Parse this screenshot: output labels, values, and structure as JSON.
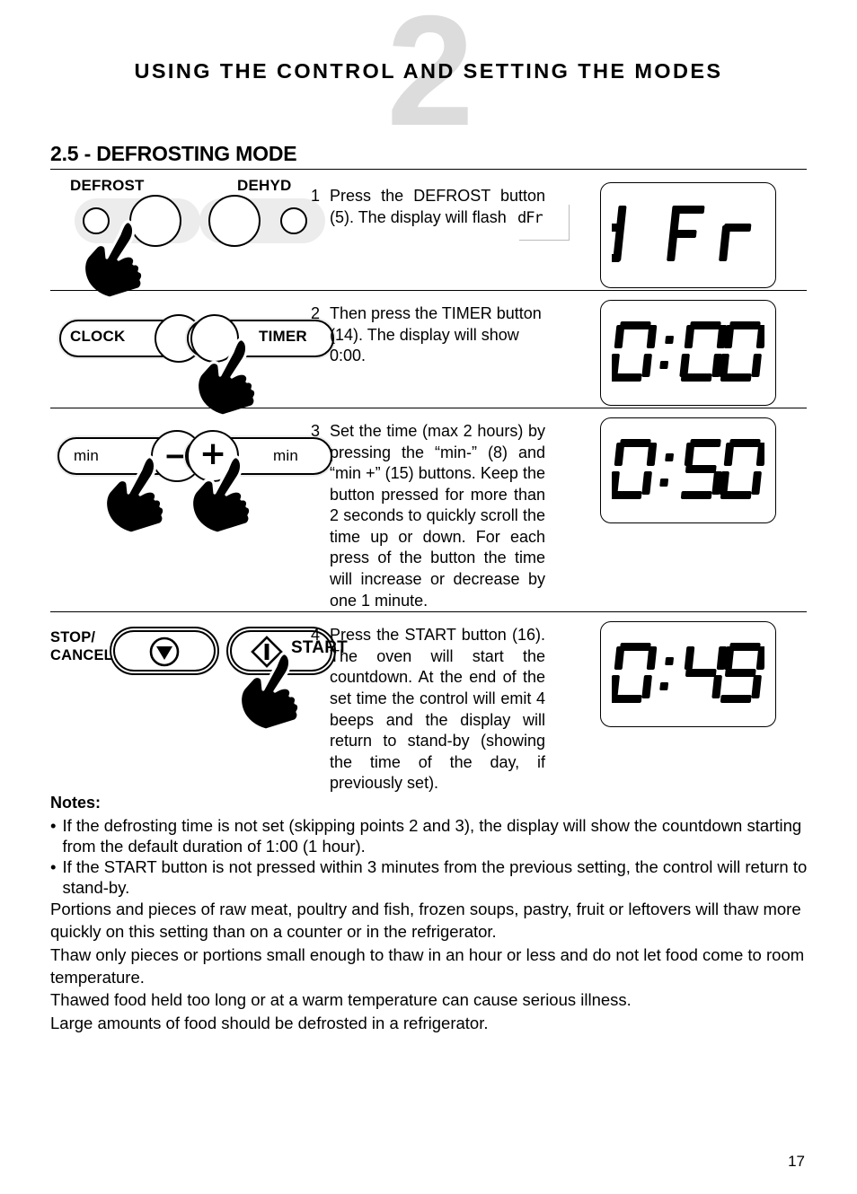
{
  "header": {
    "watermark": "2",
    "title": "USING THE CONTROL AND SETTING THE MODES"
  },
  "section": {
    "title": "2.5 - DEFROSTING MODE"
  },
  "steps": [
    {
      "number": "1",
      "text": "Press the DEFROST button (5). The display will flash",
      "display": "dFr",
      "panel": {
        "left_label": "DEFROST",
        "right_label": "DEHYD"
      }
    },
    {
      "number": "2",
      "text": "Then press the TIMER button (14). The display will show 0:00.",
      "display": "0:00",
      "panel": {
        "left_label": "CLOCK",
        "right_label": "TIMER"
      }
    },
    {
      "number": "3",
      "text": "Set the time (max 2 hours) by pressing the “min-” (8) and “min +” (15) buttons. Keep the button pressed for more than 2 seconds to quickly scroll the time up or down. For each press of the button the time will increase or decrease by one 1 minute.",
      "display": "0:50",
      "panel": {
        "left_label": "min",
        "right_label": "min",
        "left_symbol": "−",
        "right_symbol": "+"
      }
    },
    {
      "number": "4",
      "text": "Press the START button (16). The oven will start the countdown. At the end of the set time the control will emit 4 beeps and the display will return to stand-by (showing the time of the day, if previously set).",
      "display": "0:49",
      "panel": {
        "left_label": "STOP/",
        "left_label2": "CANCEL",
        "right_label": "START"
      }
    }
  ],
  "artifact": {
    "text": "dFr"
  },
  "notes": {
    "heading": "Notes:",
    "bullet": "•",
    "items": [
      "If the defrosting time is not set (skipping points 2 and 3), the display will show the countdown starting from the default duration of 1:00  (1 hour).",
      "If the START button is not pressed within 3 minutes from the previous setting, the control will return to stand-by."
    ]
  },
  "paragraphs": [
    "Portions and pieces of raw meat, poultry and fish, frozen soups, pastry, fruit or leftovers will thaw more quickly on this setting than on a counter or in the refrigerator.",
    "Thaw only pieces or portions small enough to thaw in an hour or less and do not let food come to room temperature.",
    "Thawed food held too long or at a warm temperature can cause serious illness.",
    "Large amounts of food should be defrosted in a refrigerator."
  ],
  "footer": {
    "page_number": "17"
  }
}
